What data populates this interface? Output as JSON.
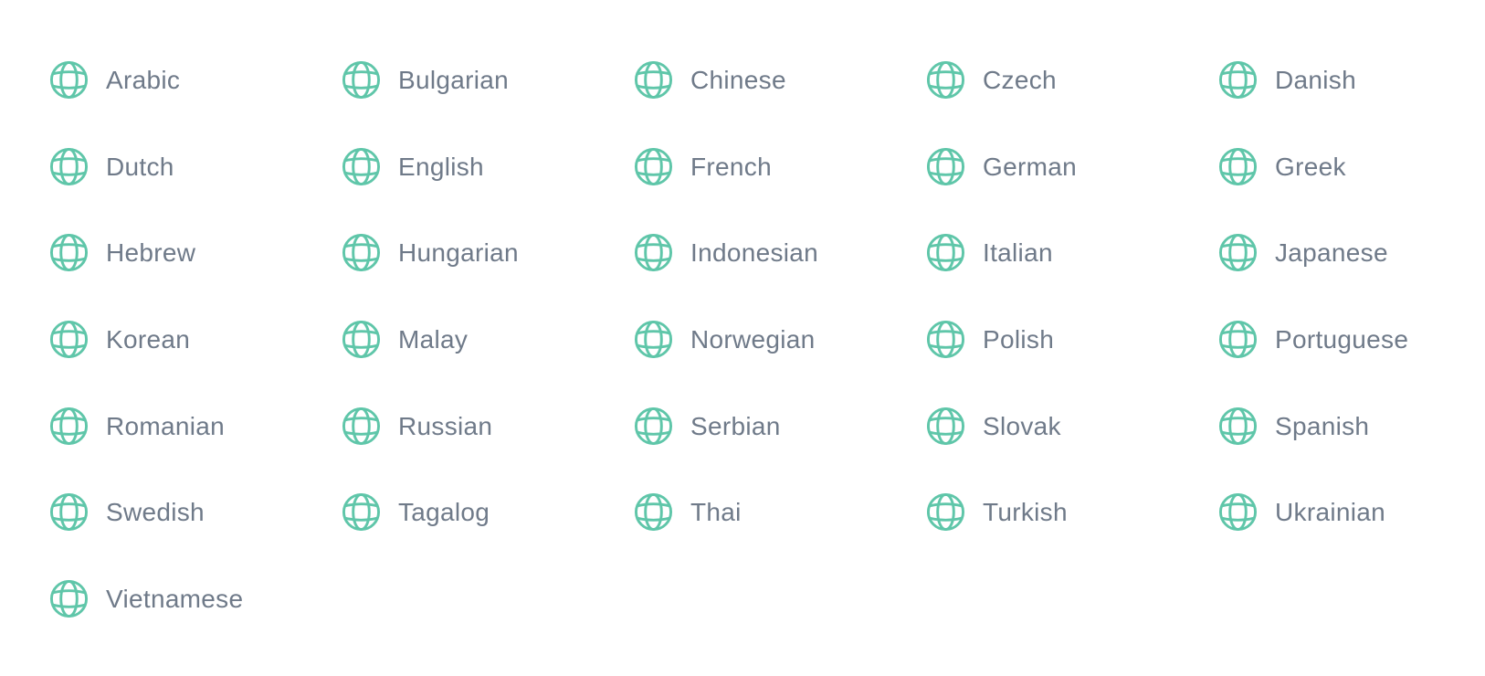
{
  "colors": {
    "icon": "#5fc6a9",
    "text": "#6f7a89",
    "background": "#ffffff"
  },
  "icon": "globe-icon",
  "languages": [
    {
      "label": "Arabic"
    },
    {
      "label": "Bulgarian"
    },
    {
      "label": "Chinese"
    },
    {
      "label": "Czech"
    },
    {
      "label": "Danish"
    },
    {
      "label": "Dutch"
    },
    {
      "label": "English"
    },
    {
      "label": "French"
    },
    {
      "label": "German"
    },
    {
      "label": "Greek"
    },
    {
      "label": "Hebrew"
    },
    {
      "label": "Hungarian"
    },
    {
      "label": "Indonesian"
    },
    {
      "label": "Italian"
    },
    {
      "label": "Japanese"
    },
    {
      "label": "Korean"
    },
    {
      "label": "Malay"
    },
    {
      "label": "Norwegian"
    },
    {
      "label": "Polish"
    },
    {
      "label": "Portuguese"
    },
    {
      "label": "Romanian"
    },
    {
      "label": "Russian"
    },
    {
      "label": "Serbian"
    },
    {
      "label": "Slovak"
    },
    {
      "label": "Spanish"
    },
    {
      "label": "Swedish"
    },
    {
      "label": "Tagalog"
    },
    {
      "label": "Thai"
    },
    {
      "label": "Turkish"
    },
    {
      "label": "Ukrainian"
    },
    {
      "label": "Vietnamese"
    }
  ]
}
